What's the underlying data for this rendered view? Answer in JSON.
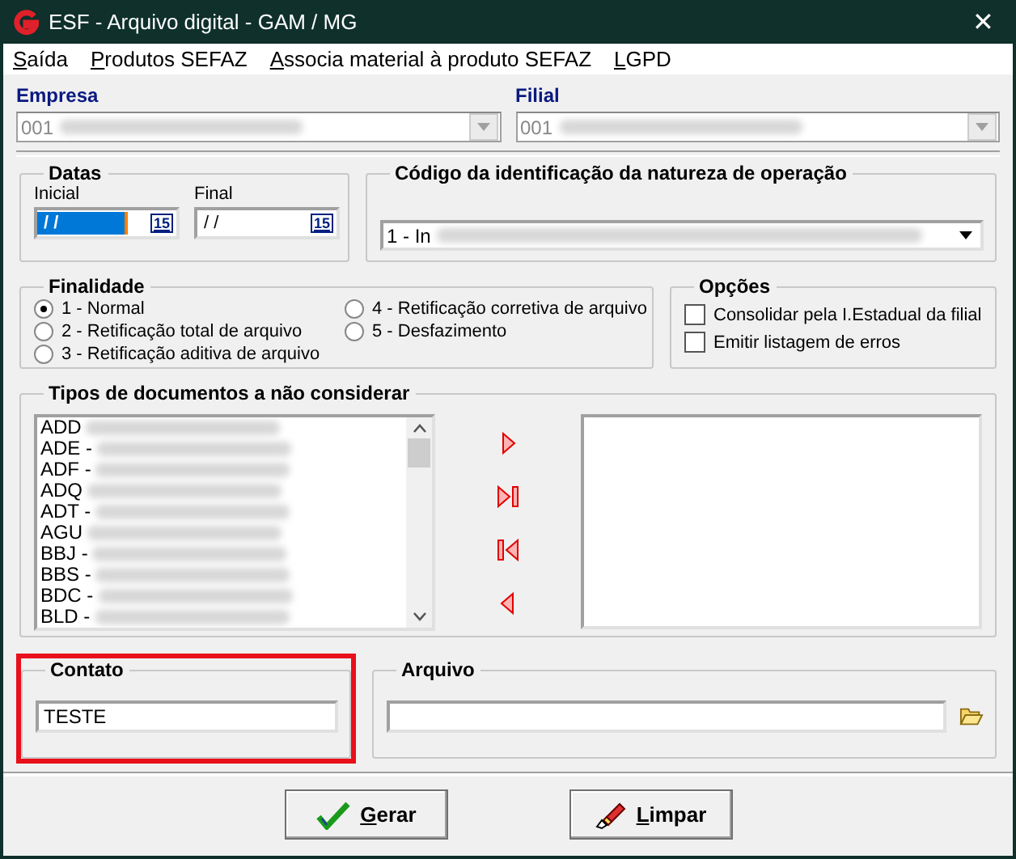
{
  "window": {
    "title": "ESF - Arquivo digital - GAM / MG",
    "close": "✕"
  },
  "menu": [
    {
      "label": "Saída"
    },
    {
      "label": "Produtos SEFAZ"
    },
    {
      "label": "Associa material à produto SEFAZ"
    },
    {
      "label": "LGPD"
    }
  ],
  "empresa": {
    "label": "Empresa",
    "value": "001",
    "disabled": true
  },
  "filial": {
    "label": "Filial",
    "value": "001",
    "disabled": true
  },
  "datas": {
    "title": "Datas",
    "fields": [
      {
        "label": "Inicial",
        "value": "/ /",
        "text_selected": true,
        "calendar": "15"
      },
      {
        "label": "Final",
        "value": "/ /",
        "text_selected": false,
        "calendar": "15"
      }
    ]
  },
  "natureza": {
    "title": "Código da identificação da natureza de operação",
    "value": "1 - In"
  },
  "finalidade": {
    "title": "Finalidade",
    "options": [
      {
        "label": "1 - Normal",
        "selected": true
      },
      {
        "label": "2 - Retificação total de arquivo",
        "selected": false
      },
      {
        "label": "3 - Retificação aditiva de arquivo",
        "selected": false
      },
      {
        "label": "4 - Retificação corretiva de arquivo",
        "selected": false
      },
      {
        "label": "5 - Desfazimento",
        "selected": false
      }
    ]
  },
  "opcoes": {
    "title": "Opções",
    "items": [
      {
        "label": "Consolidar pela I.Estadual da filial",
        "checked": false
      },
      {
        "label": "Emitir listagem de erros",
        "checked": false
      }
    ]
  },
  "tipos": {
    "title": "Tipos de documentos a não considerar",
    "items": [
      "ADD",
      "ADE -",
      "ADF -",
      "ADQ",
      "ADT -",
      "AGU",
      "BBJ -",
      "BBS -",
      "BDC -",
      "BLD -"
    ]
  },
  "contato": {
    "title": "Contato",
    "value": "TESTE",
    "highlighted": true
  },
  "arquivo": {
    "title": "Arquivo"
  },
  "buttons": [
    {
      "label": "Gerar",
      "kind": "generate"
    },
    {
      "label": "Limpar",
      "kind": "clear"
    }
  ]
}
